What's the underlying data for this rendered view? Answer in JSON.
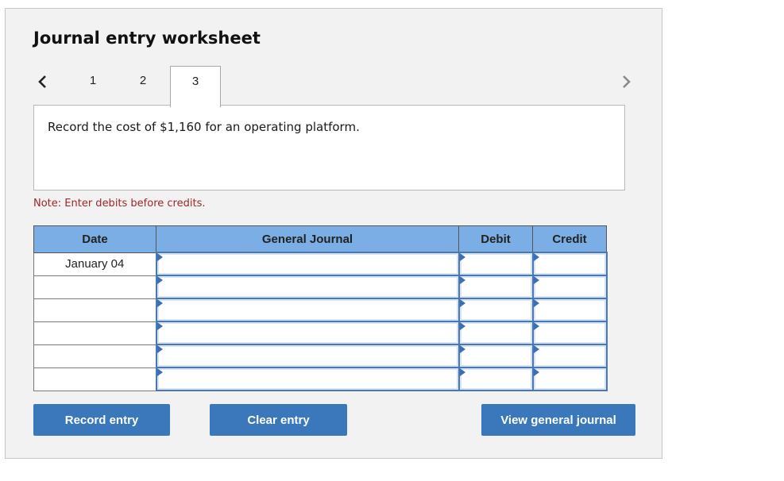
{
  "worksheet": {
    "title": "Journal entry worksheet",
    "nav": {
      "prev_icon": "chevron-left-icon",
      "next_icon": "chevron-right-icon"
    },
    "tabs": [
      {
        "label": "1",
        "active": false
      },
      {
        "label": "2",
        "active": false
      },
      {
        "label": "3",
        "active": true
      }
    ],
    "prompt": "Record the cost of $1,160 for an operating platform.",
    "note": "Note: Enter debits before credits."
  },
  "table": {
    "headers": {
      "date": "Date",
      "journal": "General Journal",
      "debit": "Debit",
      "credit": "Credit"
    },
    "rows": [
      {
        "date": "January 04",
        "account": "",
        "debit": "",
        "credit": ""
      },
      {
        "date": "",
        "account": "",
        "debit": "",
        "credit": ""
      },
      {
        "date": "",
        "account": "",
        "debit": "",
        "credit": ""
      },
      {
        "date": "",
        "account": "",
        "debit": "",
        "credit": ""
      },
      {
        "date": "",
        "account": "",
        "debit": "",
        "credit": ""
      },
      {
        "date": "",
        "account": "",
        "debit": "",
        "credit": ""
      }
    ]
  },
  "buttons": {
    "record": "Record entry",
    "clear": "Clear entry",
    "view": "View general journal"
  },
  "colors": {
    "header_bg": "#7aaee4",
    "button_bg": "#3a78bb",
    "note_text": "#a0262b",
    "input_border": "#4a78b5"
  }
}
